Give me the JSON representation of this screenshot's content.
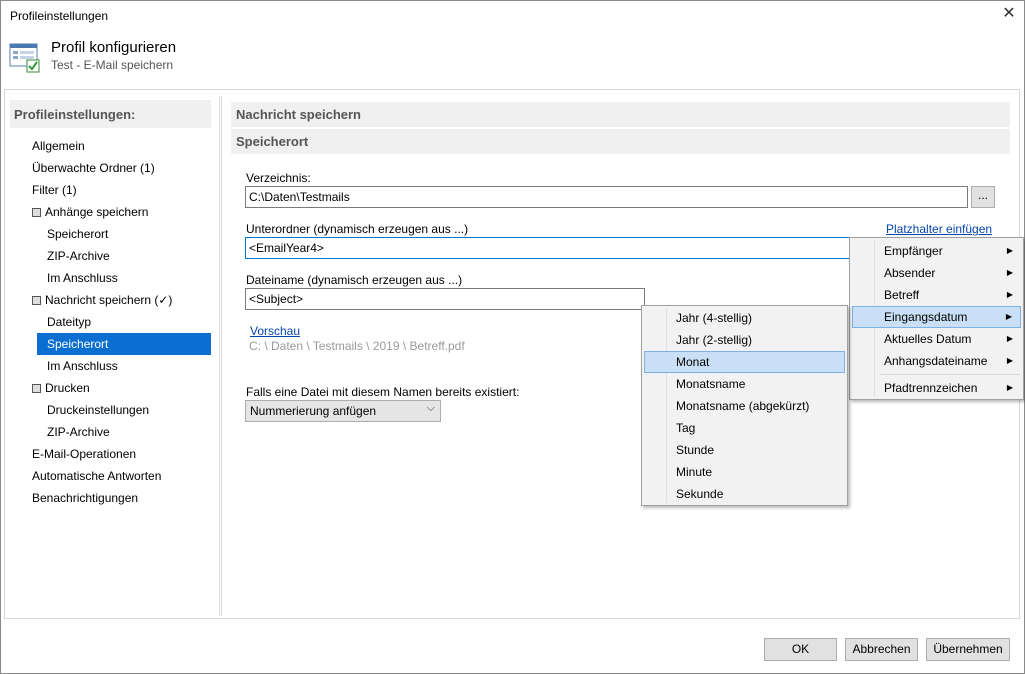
{
  "window": {
    "title": "Profileinstellungen",
    "close_glyph": "✕"
  },
  "header": {
    "title": "Profil konfigurieren",
    "subtitle": "Test - E-Mail speichern",
    "icon": "settings-window-check-icon"
  },
  "sidebar": {
    "heading": "Profileinstellungen:",
    "items": [
      {
        "label": "Allgemein"
      },
      {
        "label": "Überwachte Ordner (1)"
      },
      {
        "label": "Filter (1)"
      },
      {
        "label": "Anhänge speichern",
        "icon": "attachment-save-icon"
      },
      {
        "label": "Speicherort"
      },
      {
        "label": "ZIP-Archive"
      },
      {
        "label": "Im Anschluss"
      },
      {
        "label": "Nachricht speichern (✓)",
        "icon": "message-save-icon"
      },
      {
        "label": "Dateityp"
      },
      {
        "label": "Speicherort",
        "selected": true
      },
      {
        "label": "Im Anschluss"
      },
      {
        "label": "Drucken",
        "icon": "printer-icon"
      },
      {
        "label": "Druckeinstellungen"
      },
      {
        "label": "ZIP-Archive"
      },
      {
        "label": "E-Mail-Operationen"
      },
      {
        "label": "Automatische Antworten"
      },
      {
        "label": "Benachrichtigungen"
      }
    ]
  },
  "main": {
    "section_title": "Nachricht speichern",
    "subsection_title": "Speicherort",
    "directory": {
      "label": "Verzeichnis:",
      "value": "C:\\Daten\\Testmails",
      "browse_label": "..."
    },
    "subfolder": {
      "label": "Unterordner (dynamisch erzeugen aus ...)",
      "value": "<EmailYear4>",
      "placeholder_link": "Platzhalter einfügen"
    },
    "filename": {
      "label": "Dateiname (dynamisch erzeugen aus ...)",
      "value": "<Subject>"
    },
    "preview": {
      "link": "Vorschau",
      "path": "C: \\ Daten \\ Testmails \\ 2019 \\ Betreff.pdf"
    },
    "exists": {
      "label": "Falls eine Datei mit diesem Namen bereits existiert:",
      "selected": "Nummerierung anfügen"
    }
  },
  "context_menu": {
    "items": [
      {
        "label": "Empfänger",
        "submenu": true
      },
      {
        "label": "Absender",
        "submenu": true
      },
      {
        "label": "Betreff",
        "submenu": true
      },
      {
        "label": "Eingangsdatum",
        "submenu": true,
        "highlighted": true
      },
      {
        "label": "Aktuelles Datum",
        "submenu": true
      },
      {
        "label": "Anhangsdateiname",
        "submenu": true
      },
      {
        "label": "Pfadtrennzeichen",
        "submenu": true
      }
    ],
    "arrow_glyph": "▶"
  },
  "date_submenu": {
    "items": [
      {
        "label": "Jahr (4-stellig)"
      },
      {
        "label": "Jahr (2-stellig)"
      },
      {
        "label": "Monat",
        "highlighted": true
      },
      {
        "label": "Monatsname"
      },
      {
        "label": "Monatsname (abgekürzt)"
      },
      {
        "label": "Tag"
      },
      {
        "label": "Stunde"
      },
      {
        "label": "Minute"
      },
      {
        "label": "Sekunde"
      }
    ]
  },
  "footer": {
    "ok_label": "OK",
    "cancel_label": "Abbrechen",
    "apply_label": "Übernehmen"
  },
  "colors": {
    "selection": "#0a6fd0",
    "menu_hover": "#c8dff5",
    "link": "#0645ad"
  }
}
